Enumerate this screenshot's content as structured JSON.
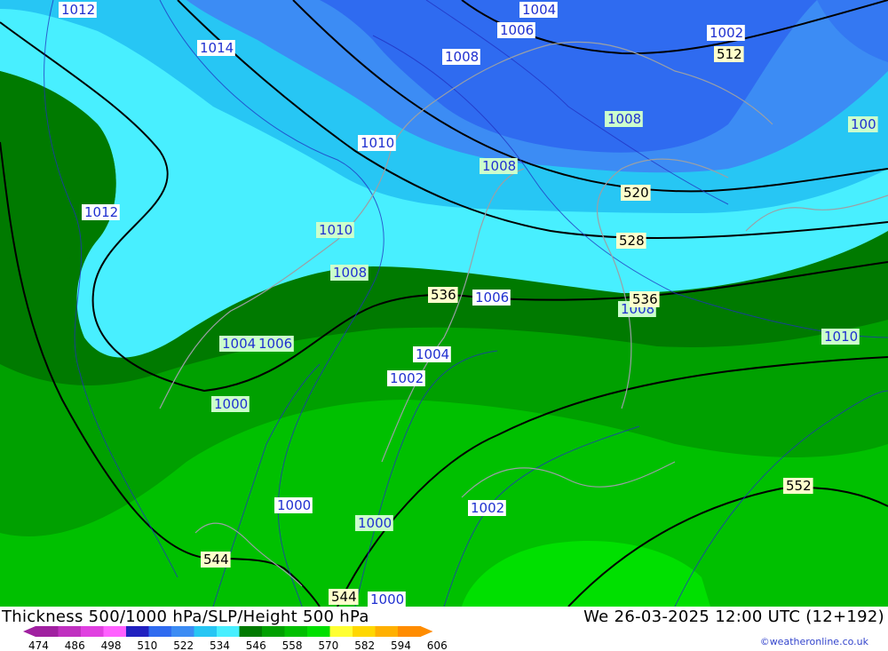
{
  "map": {
    "bands": [
      {
        "name": "band-blue-4",
        "color": "#2f6bf0"
      },
      {
        "name": "band-blue-3",
        "color": "#3c8cf4"
      },
      {
        "name": "band-cyan-2",
        "color": "#27c6f4"
      },
      {
        "name": "band-cyan-1",
        "color": "#48efff"
      },
      {
        "name": "band-dgreen",
        "color": "#007a00"
      },
      {
        "name": "band-green-2",
        "color": "#00a000"
      },
      {
        "name": "band-green-1",
        "color": "#00c000"
      },
      {
        "name": "band-green-0",
        "color": "#00e000"
      }
    ],
    "slp_labels": [
      "1012",
      "1014",
      "1004",
      "1006",
      "1002",
      "1008",
      "1008",
      "1010",
      "1008",
      "1012",
      "1010",
      "1008",
      "1006",
      "1008",
      "1010",
      "1004",
      "1006",
      "1004",
      "1002",
      "1000",
      "1000",
      "1000",
      "1002",
      "1000",
      "100"
    ],
    "height_labels": [
      "512",
      "520",
      "528",
      "536",
      "536",
      "544",
      "544",
      "552"
    ]
  },
  "footer": {
    "title_left": "Thickness 500/1000 hPa/SLP/Height 500 hPa",
    "title_right": "We 26-03-2025 12:00 UTC (12+192)",
    "copyright": "©weatheronline.co.uk"
  },
  "scale": {
    "colors": [
      "#a020a0",
      "#c030c0",
      "#e040e0",
      "#ff60ff",
      "#2020c0",
      "#2f6bf0",
      "#3c8cf4",
      "#27c6f4",
      "#48efff",
      "#007a00",
      "#00a000",
      "#00c000",
      "#00e000",
      "#ffff33",
      "#ffd700",
      "#ffb000",
      "#ff8c00"
    ],
    "ticks": [
      "474",
      "486",
      "498",
      "510",
      "522",
      "534",
      "546",
      "558",
      "570",
      "582",
      "594",
      "606"
    ]
  }
}
